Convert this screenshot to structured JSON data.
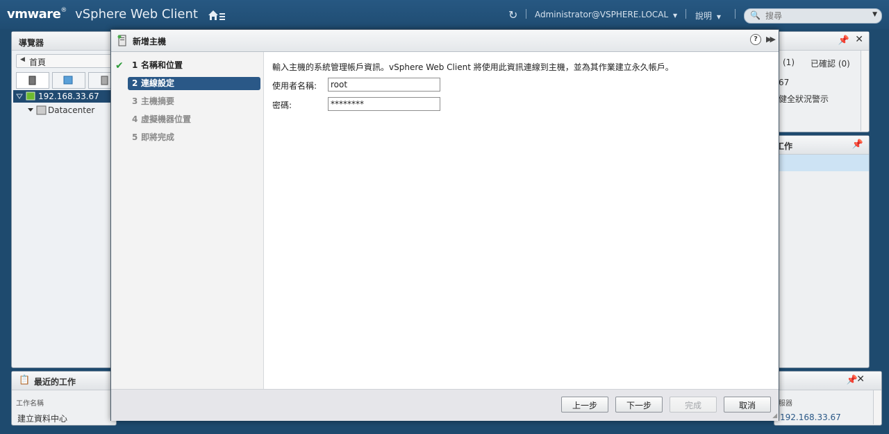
{
  "topbar": {
    "brand_vm": "vmware",
    "brand_client": "vSphere Web Client",
    "user": "Administrator@VSPHERE.LOCAL",
    "help": "說明",
    "search_placeholder": "搜尋"
  },
  "navigator": {
    "title": "導覽器",
    "home": "首頁",
    "tree": [
      {
        "label": "192.168.33.67"
      },
      {
        "label": "Datacenter"
      }
    ]
  },
  "right_panels": {
    "badge_count": "(1)",
    "acknowledged": "已確認 (0)",
    "ip_fragment": "67",
    "alert_fragment": "健全狀況警示",
    "tasks_fragment": "工作",
    "server_fragment": "服器",
    "server_ip": "192.168.33.67"
  },
  "recent_tasks": {
    "title": "最近的工作",
    "col_task_name": "工作名稱",
    "row1": "建立資料中心"
  },
  "dialog": {
    "title": "新增主機",
    "steps": [
      {
        "num": "1",
        "label": "名稱和位置"
      },
      {
        "num": "2",
        "label": "連線設定"
      },
      {
        "num": "3",
        "label": "主機摘要"
      },
      {
        "num": "4",
        "label": "虛擬機器位置"
      },
      {
        "num": "5",
        "label": "即將完成"
      }
    ],
    "intro": "輸入主機的系統管理帳戶資訊。vSphere Web Client 將使用此資訊連線到主機，並為其作業建立永久帳戶。",
    "username_label": "使用者名稱:",
    "username_value": "root",
    "password_label": "密碼:",
    "password_value": "********",
    "buttons": {
      "back": "上一步",
      "next": "下一步",
      "finish": "完成",
      "cancel": "取消"
    }
  }
}
